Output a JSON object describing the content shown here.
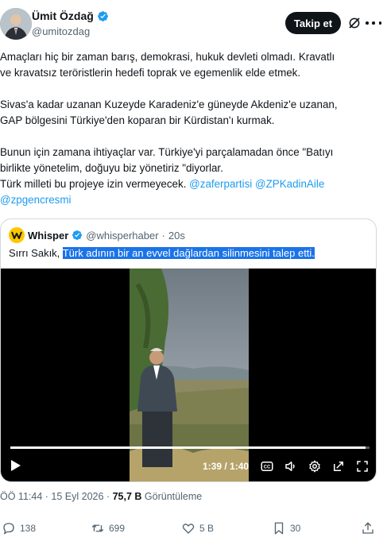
{
  "author": {
    "display_name": "Ümit Özdağ",
    "handle": "@umitozdag",
    "verified_color": "#1d9bf0",
    "follow_label": "Takip et"
  },
  "tweet": {
    "paragraph_1": "Amaçları hiç bir zaman barış, demokrasi, hukuk devleti olmadı. Kravatlı\nve kravatsız teröristlerin hedefi toprak ve egemenlik elde etmek.",
    "paragraph_2": "Sivas'a kadar uzanan Kuzeyde Karadeniz'e güneyde Akdeniz'e uzanan,\nGAP bölgesini Türkiye'den koparan bir Kürdistan'ı kurmak.",
    "paragraph_3_line_1": "Bunun için zamana ihtiyaçlar var. Türkiye'yi parçalamadan önce \"Batıyı",
    "paragraph_3_line_2": "birlikte yönetelim, doğuyu biz yönetiriz \"diyorlar.",
    "paragraph_3_line_3": "Türk milleti bu projeye izin vermeyecek.",
    "mention_1": "@zaferpartisi",
    "mention_2": "@ZPKadinAile",
    "mention_3": "@zpgencresmi"
  },
  "quote": {
    "name": "Whisper",
    "handle": "@whisperhaber",
    "time": "20s",
    "text_prefix": "Sırrı Sakık,",
    "text_highlight": "Türk adının bir an evvel dağlardan silinmesini talep etti.",
    "video": {
      "time_label": "1:39 / 1:40",
      "progress": 0.99
    }
  },
  "meta": {
    "time": "ÖÖ 11:44",
    "date": "15 Eyl 2026",
    "views": "75,7 B",
    "views_label": "Görüntüleme"
  },
  "actions": {
    "replies": "138",
    "reposts": "699",
    "likes": "5 B",
    "bookmarks": "30"
  },
  "colors": {
    "accent": "#1d9bf0",
    "text": "#0f1419",
    "muted": "#536471",
    "highlight": "#1a73e8",
    "whisper_brand": "#ffc700"
  },
  "icons": [
    "verified-badge-icon",
    "grok-icon",
    "more-icon",
    "play-icon",
    "captions-icon",
    "volume-icon",
    "settings-icon",
    "popout-icon",
    "fullscreen-icon",
    "reply-icon",
    "repost-icon",
    "like-icon",
    "bookmark-icon",
    "share-icon"
  ]
}
